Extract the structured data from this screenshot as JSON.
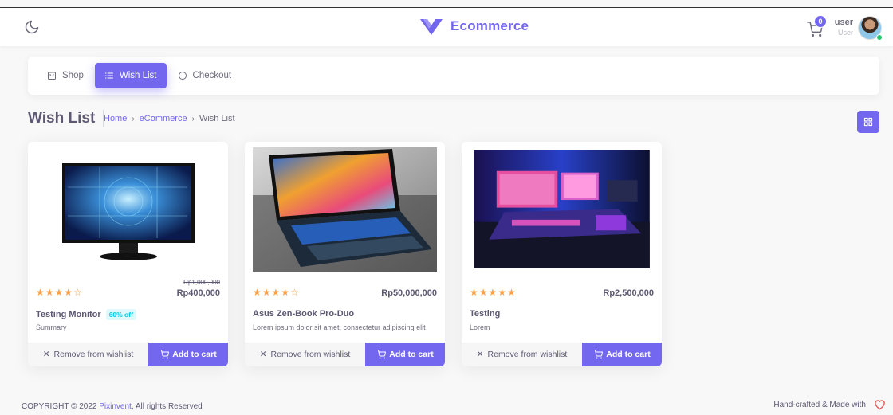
{
  "brand": {
    "name": "Ecommerce",
    "color": "#7367f0"
  },
  "navbar": {
    "theme_icon": "moon-icon",
    "cart_count": "0",
    "user_name": "user",
    "user_role": "User"
  },
  "tabs": [
    {
      "label": "Shop",
      "icon": "shopping-bag-icon",
      "active": false
    },
    {
      "label": "Wish List",
      "icon": "list-icon",
      "active": true
    },
    {
      "label": "Checkout",
      "icon": "circle-icon",
      "active": false
    }
  ],
  "page": {
    "title": "Wish List",
    "breadcrumb": [
      "Home",
      "eCommerce",
      "Wish List"
    ],
    "breadcrumb_sep": "›"
  },
  "products": [
    {
      "name": "Testing Monitor",
      "badge": "60% off",
      "description": "Summary",
      "price": "Rp400,000",
      "old_price": "Rp1,000,000",
      "rating": 4,
      "remove_label": "Remove from wishlist",
      "cart_label": "Add to cart"
    },
    {
      "name": "Asus Zen-Book Pro-Duo",
      "badge": "",
      "description": "Lorem ipsum dolor sit amet, consectetur adipiscing elit",
      "price": "Rp50,000,000",
      "old_price": "",
      "rating": 4,
      "remove_label": "Remove from wishlist",
      "cart_label": "Add to cart"
    },
    {
      "name": "Testing",
      "badge": "",
      "description": "Lorem",
      "price": "Rp2,500,000",
      "old_price": "",
      "rating": 5,
      "remove_label": "Remove from wishlist",
      "cart_label": "Add to cart"
    }
  ],
  "footer": {
    "copyright": "COPYRIGHT © 2022",
    "company": "Pixinvent",
    "rights": ", All rights Reserved",
    "made_with": "Hand-crafted & Made with"
  }
}
